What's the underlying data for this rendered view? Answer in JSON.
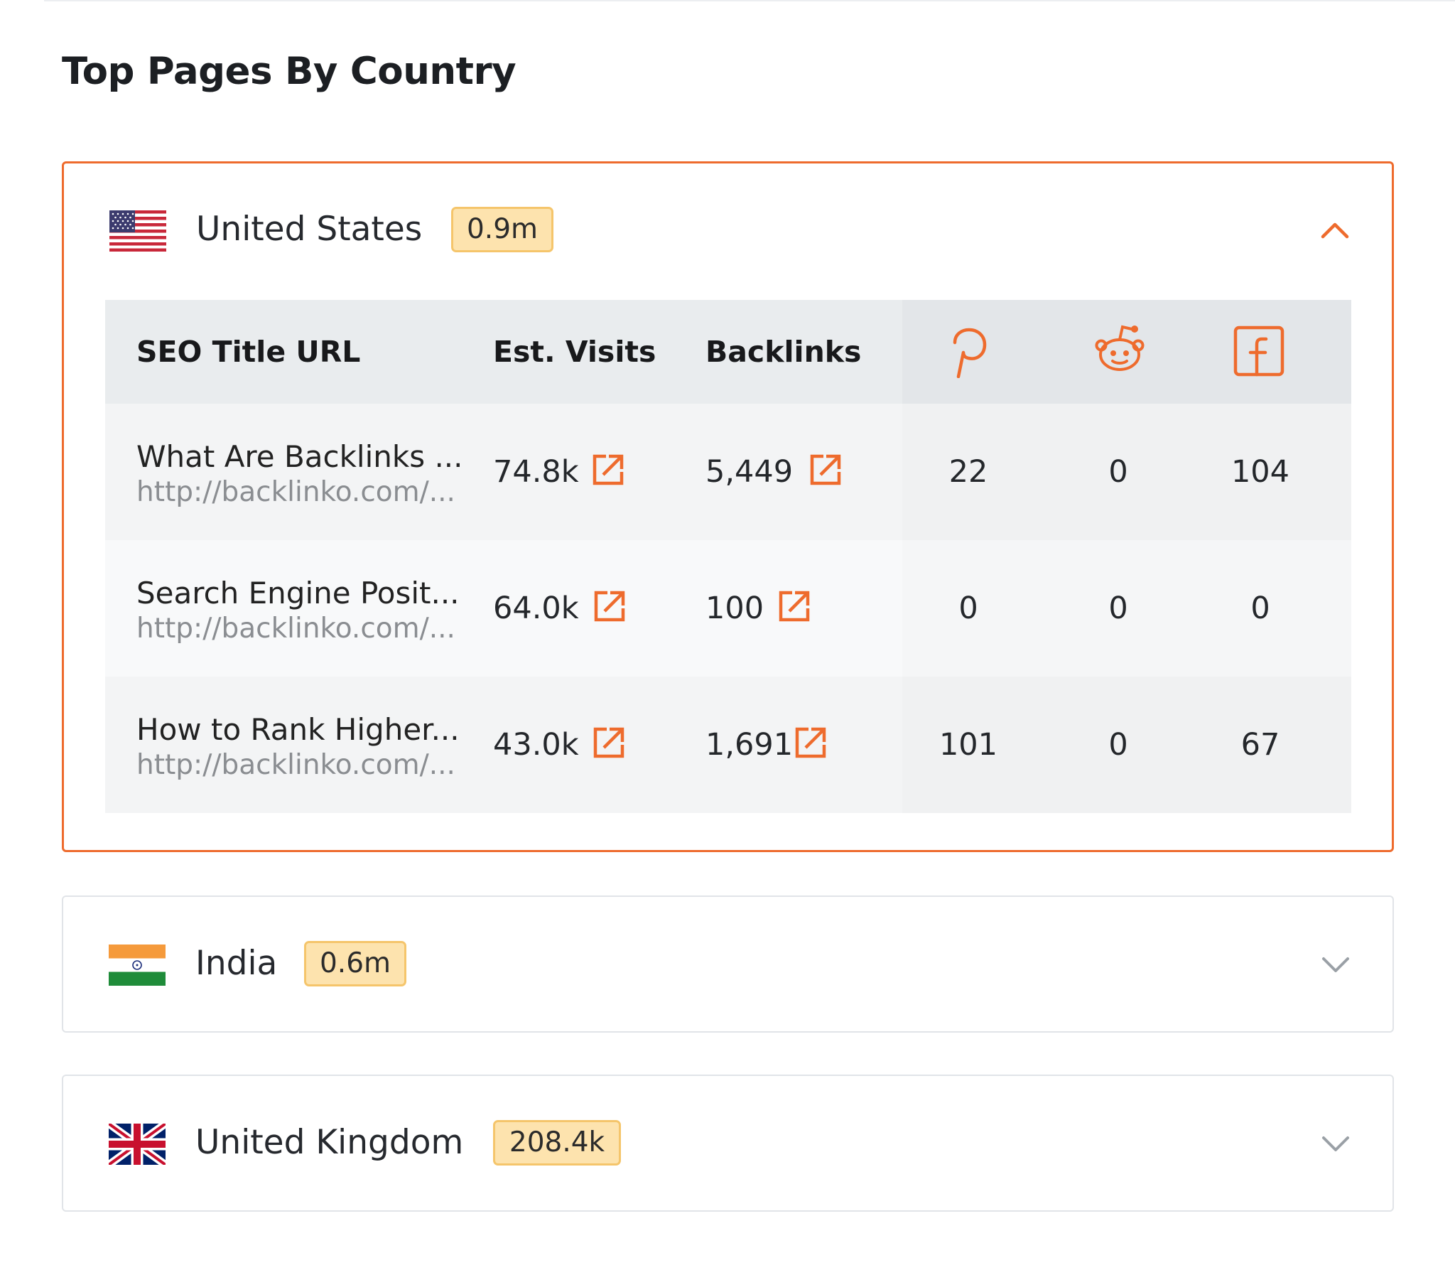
{
  "page": {
    "title": "Top Pages By Country"
  },
  "colors": {
    "accent": "#ee6b2d",
    "badge_bg": "#fde3ae",
    "badge_border": "#f5c56b"
  },
  "countries": [
    {
      "name": "United States",
      "traffic": "0.9m",
      "flag": "us-flag-icon",
      "expanded": true
    },
    {
      "name": "India",
      "traffic": "0.6m",
      "flag": "india-flag-icon",
      "expanded": false
    },
    {
      "name": "United Kingdom",
      "traffic": "208.4k",
      "flag": "uk-flag-icon",
      "expanded": false
    }
  ],
  "table": {
    "headers": {
      "seo_title_url": "SEO Title URL",
      "est_visits": "Est. Visits",
      "backlinks": "Backlinks",
      "pinterest": "pinterest-icon",
      "reddit": "reddit-icon",
      "facebook": "facebook-icon"
    },
    "rows": [
      {
        "title": "What Are Backlinks ...",
        "url": "http://backlinko.com/...",
        "visits": "74.8k",
        "backlinks": "5,449",
        "pinterest": "22",
        "reddit": "0",
        "facebook": "104"
      },
      {
        "title": "Search Engine Posit...",
        "url": "http://backlinko.com/...",
        "visits": "64.0k",
        "backlinks": "100",
        "pinterest": "0",
        "reddit": "0",
        "facebook": "0"
      },
      {
        "title": "How to Rank Higher...",
        "url": "http://backlinko.com/...",
        "visits": "43.0k",
        "backlinks": "1,691",
        "pinterest": "101",
        "reddit": "0",
        "facebook": "67"
      }
    ]
  }
}
